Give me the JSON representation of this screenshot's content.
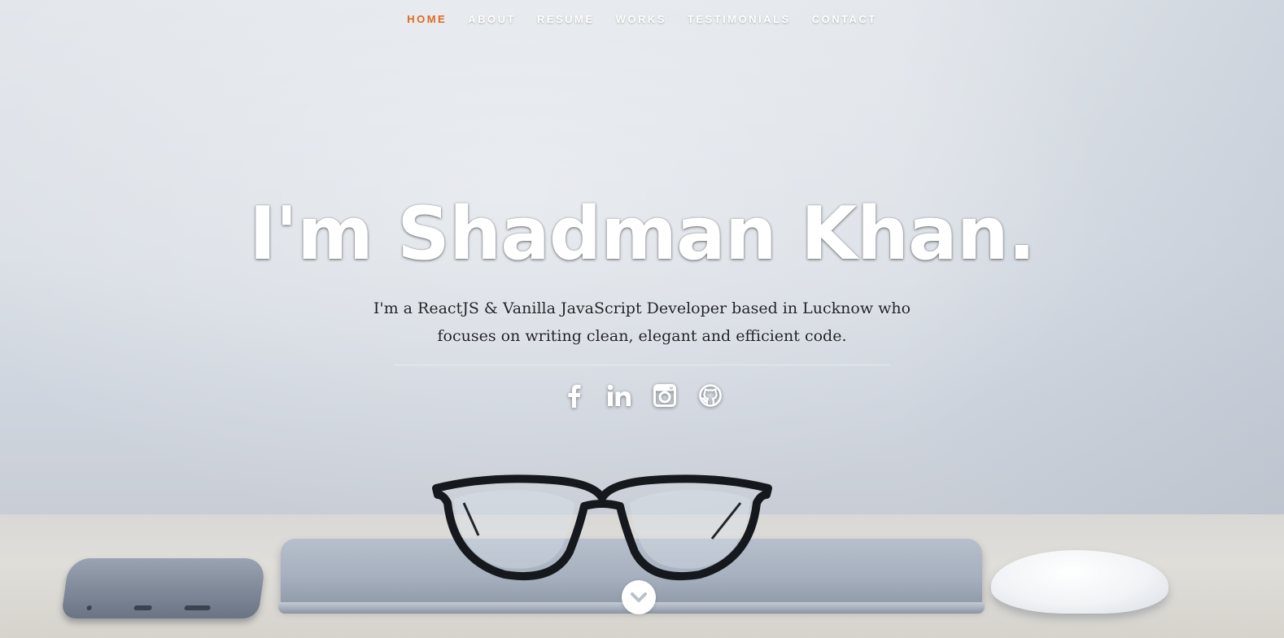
{
  "nav": {
    "items": [
      {
        "label": "HOME",
        "active": true
      },
      {
        "label": "ABOUT",
        "active": false
      },
      {
        "label": "RESUME",
        "active": false
      },
      {
        "label": "WORKS",
        "active": false
      },
      {
        "label": "TESTIMONIALS",
        "active": false
      },
      {
        "label": "CONTACT",
        "active": false
      }
    ],
    "active_color": "#e06a1b",
    "text_color": "#ffffff"
  },
  "hero": {
    "headline": "I'm Shadman Khan.",
    "tagline": "I'm a ReactJS & Vanilla JavaScript Developer based in Lucknow who focuses on writing clean, elegant and efficient code."
  },
  "social": [
    {
      "icon": "facebook-icon"
    },
    {
      "icon": "linkedin-icon"
    },
    {
      "icon": "instagram-icon"
    },
    {
      "icon": "github-icon"
    }
  ],
  "scroll_button": {
    "icon": "chevron-down-icon"
  }
}
